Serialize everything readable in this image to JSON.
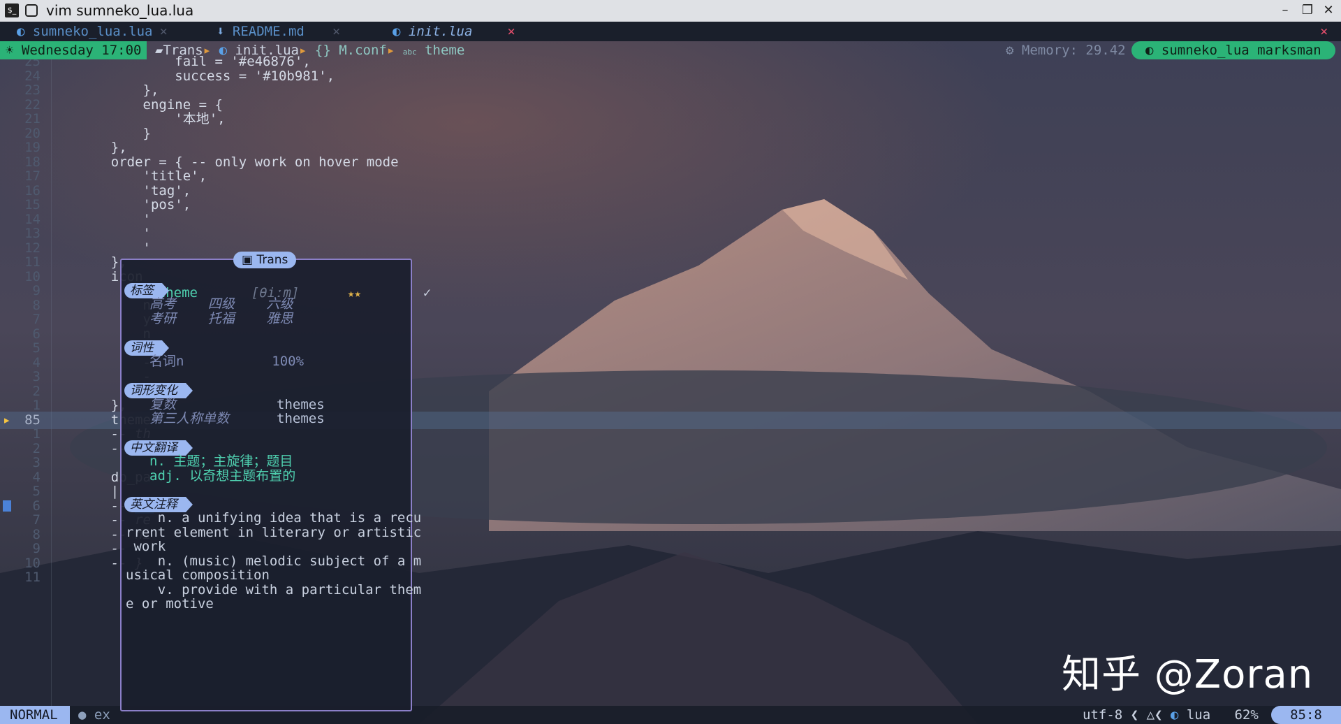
{
  "window": {
    "title": "vim sumneko_lua.lua",
    "app_icon_label": "$_"
  },
  "tabs": [
    {
      "label": "sumneko_lua.lua",
      "active": false
    },
    {
      "label": "README.md",
      "active": false
    },
    {
      "label": "init.lua",
      "active": true
    }
  ],
  "tab_close": "×",
  "winbar": {
    "date": "Wednesday 17:00",
    "crumbs": [
      "Trans",
      "init.lua",
      "M.conf",
      "theme"
    ],
    "memory": "Memory: 29.42",
    "lsp": "sumneko_lua  marksman"
  },
  "editor_lines": [
    {
      "ln": "25",
      "code": "            fail = '#e46876',"
    },
    {
      "ln": "24",
      "code": "            success = '#10b981',"
    },
    {
      "ln": "23",
      "code": "        },"
    },
    {
      "ln": "22",
      "code": "        engine = {"
    },
    {
      "ln": "21",
      "code": "            '本地',"
    },
    {
      "ln": "20",
      "code": "        }"
    },
    {
      "ln": "19",
      "code": "    },"
    },
    {
      "ln": "18",
      "code": "    order = { -- only work on hover mode"
    },
    {
      "ln": "17",
      "code": "        'title',"
    },
    {
      "ln": "16",
      "code": "        'tag',"
    },
    {
      "ln": "15",
      "code": "        'pos',"
    },
    {
      "ln": "14",
      "code": "        '"
    },
    {
      "ln": "13",
      "code": "        '"
    },
    {
      "ln": "12",
      "code": "        '"
    },
    {
      "ln": "11",
      "code": "    },"
    },
    {
      "ln": "10",
      "code": "    icon"
    },
    {
      "ln": "9",
      "code": "        s"
    },
    {
      "ln": "8",
      "code": "        n"
    },
    {
      "ln": "7",
      "code": "        y"
    },
    {
      "ln": "6",
      "code": "        n"
    },
    {
      "ln": "5",
      "code": "        -"
    },
    {
      "ln": "4",
      "code": "        -"
    },
    {
      "ln": "3",
      "code": "        -"
    },
    {
      "ln": "2",
      "code": "        -"
    },
    {
      "ln": "1",
      "code": "    },"
    },
    {
      "ln": "85",
      "code": "    theme"
    },
    {
      "ln": "1",
      "code": "    -- th"
    },
    {
      "ln": "2",
      "code": "    -- th"
    },
    {
      "ln": "3",
      "code": ""
    },
    {
      "ln": "4",
      "code": "    db_pa"
    },
    {
      "ln": "5",
      "code": "    |"
    },
    {
      "ln": "6",
      "code": "    -- TO"
    },
    {
      "ln": "7",
      "code": "    -- re"
    },
    {
      "ln": "8",
      "code": "    -- hi"
    },
    {
      "ln": "9",
      "code": "    --"
    },
    {
      "ln": "10",
      "code": "    -- }"
    },
    {
      "ln": "11",
      "code": ""
    }
  ],
  "popup": {
    "title": "Trans",
    "word": "theme",
    "phonetic": "[θiːm]",
    "stars": "★★",
    "check": "✓",
    "sections": {
      "tag": "标签",
      "pos": "词性",
      "exchange": "词形变化",
      "translation": "中文翻译",
      "definition": "英文注释"
    },
    "tags_row1": "高考    四级    六级",
    "tags_row2": "考研    托福    雅思",
    "pos_line": "名词n           100%",
    "exchange_1_label": "复数",
    "exchange_1_value": "themes",
    "exchange_2_label": "第三人称单数",
    "exchange_2_value": "themes",
    "zh_1": "n. 主题；主旋律；题目",
    "zh_2": "adj. 以奇想主题布置的",
    "def_lines": [
      "    n. a unifying idea that is a recu",
      "rrent element in literary or artistic",
      " work",
      "    n. (music) melodic subject of a m",
      "usical composition",
      "    v. provide with a particular them",
      "e or motive"
    ]
  },
  "statusline": {
    "mode": "NORMAL",
    "git": "ex",
    "encoding": "utf-8",
    "filetype": "lua",
    "percent": "62%",
    "position": "85:8"
  },
  "watermark": "知乎 @Zoran",
  "colors": {
    "accent_green": "#2bb377",
    "accent_blue": "#9bb7f0",
    "popup_border": "#8b7fc8"
  }
}
